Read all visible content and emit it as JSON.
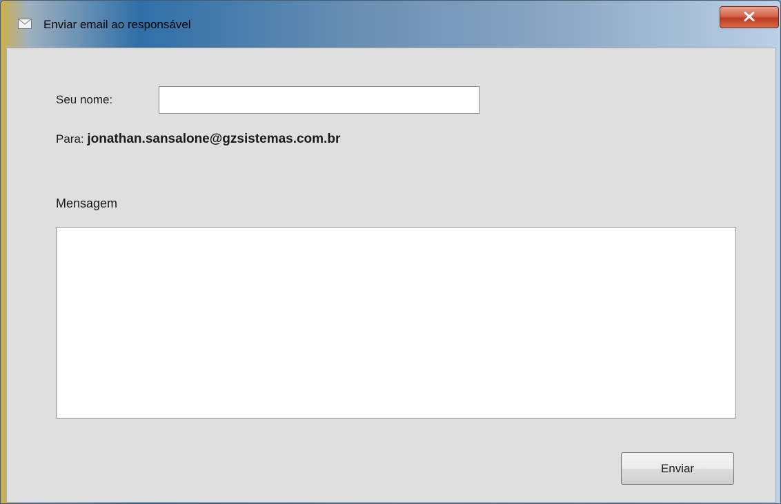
{
  "window": {
    "title": "Enviar email ao responsável",
    "close_icon": "close-icon",
    "app_icon": "envelope-icon"
  },
  "form": {
    "name_label": "Seu nome:",
    "name_value": "",
    "to_label": "Para:",
    "to_email": "jonathan.sansalone@gzsistemas.com.br",
    "message_label": "Mensagem",
    "message_value": "",
    "send_label": "Enviar"
  },
  "colors": {
    "dialog_background": "#dfdfdf",
    "close_button": "#c8442a"
  }
}
